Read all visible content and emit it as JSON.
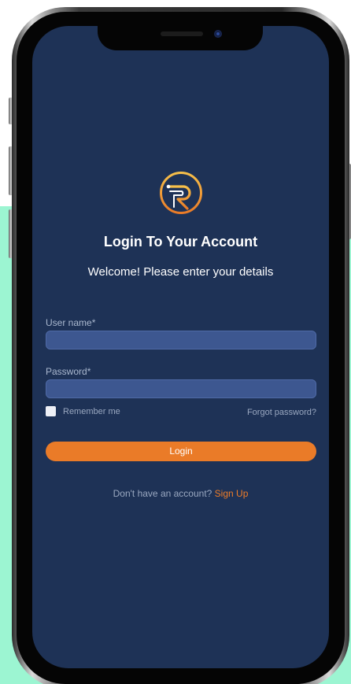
{
  "login": {
    "title": "Login To Your Account",
    "subtitle": "Welcome! Please enter your details",
    "username_label": "User name*",
    "username_value": "",
    "password_label": "Password*",
    "password_value": "",
    "remember_label": "Remember me",
    "remember_checked": false,
    "forgot_label": "Forgot password?",
    "login_label": "Login",
    "signup_prompt": "Don't have an account?",
    "signup_label": "Sign Up"
  },
  "icons": {
    "logo": "r-circuit-logo-icon"
  },
  "colors": {
    "screen_bg": "#1e3256",
    "input_bg": "#3d5790",
    "accent": "#ea7b28",
    "logo_gradient_start": "#f6c04a",
    "logo_gradient_end": "#ea7b28",
    "page_bg": "#9cf5d2"
  }
}
